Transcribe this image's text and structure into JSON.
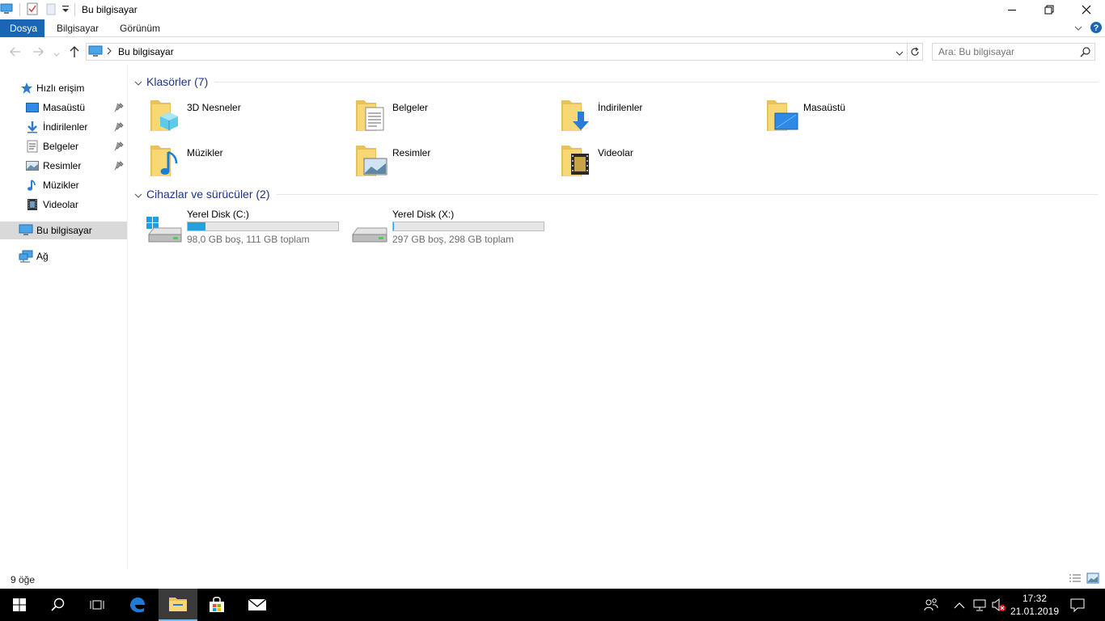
{
  "window": {
    "title": "Bu bilgisayar",
    "controls": {
      "minimize": "—",
      "maximize": "☐",
      "close": "✕"
    }
  },
  "ribbon": {
    "tabs": [
      {
        "label": "Dosya",
        "active": true
      },
      {
        "label": "Bilgisayar",
        "active": false
      },
      {
        "label": "Görünüm",
        "active": false
      }
    ]
  },
  "address": {
    "path": "Bu bilgisayar",
    "search_placeholder": "Ara: Bu bilgisayar"
  },
  "nav": {
    "quick_access": "Hızlı erişim",
    "pinned": [
      {
        "label": "Masaüstü",
        "icon": "desktop-icon",
        "pinned": true
      },
      {
        "label": "İndirilenler",
        "icon": "download-icon",
        "pinned": true
      },
      {
        "label": "Belgeler",
        "icon": "documents-icon",
        "pinned": true
      },
      {
        "label": "Resimler",
        "icon": "pictures-icon",
        "pinned": true
      },
      {
        "label": "Müzikler",
        "icon": "music-icon",
        "pinned": false
      },
      {
        "label": "Videolar",
        "icon": "videos-icon",
        "pinned": false
      }
    ],
    "this_pc": "Bu bilgisayar",
    "network": "Ağ"
  },
  "folders_group": {
    "title": "Klasörler (7)",
    "items": [
      {
        "label": "3D Nesneler",
        "icon": "3d-objects-folder-icon"
      },
      {
        "label": "Belgeler",
        "icon": "documents-folder-icon"
      },
      {
        "label": "İndirilenler",
        "icon": "downloads-folder-icon"
      },
      {
        "label": "Masaüstü",
        "icon": "desktop-folder-icon"
      },
      {
        "label": "Müzikler",
        "icon": "music-folder-icon"
      },
      {
        "label": "Resimler",
        "icon": "pictures-folder-icon"
      },
      {
        "label": "Videolar",
        "icon": "videos-folder-icon"
      }
    ]
  },
  "drives_group": {
    "title": "Cihazlar ve sürücüler (2)",
    "items": [
      {
        "label": "Yerel Disk (C:)",
        "info": "98,0 GB boş, 111 GB toplam",
        "used_fraction": 0.117,
        "icon": "system-drive-icon"
      },
      {
        "label": "Yerel Disk (X:)",
        "info": "297 GB boş, 298 GB toplam",
        "used_fraction": 0.003,
        "icon": "drive-icon"
      }
    ]
  },
  "status": {
    "item_count": "9 öğe"
  },
  "taskbar": {
    "time": "17:32",
    "date": "21.01.2019"
  },
  "colors": {
    "accent": "#1a65b5",
    "group_header": "#1e3287",
    "drive_fill": "#26a0da",
    "folder": "#f8d775"
  }
}
